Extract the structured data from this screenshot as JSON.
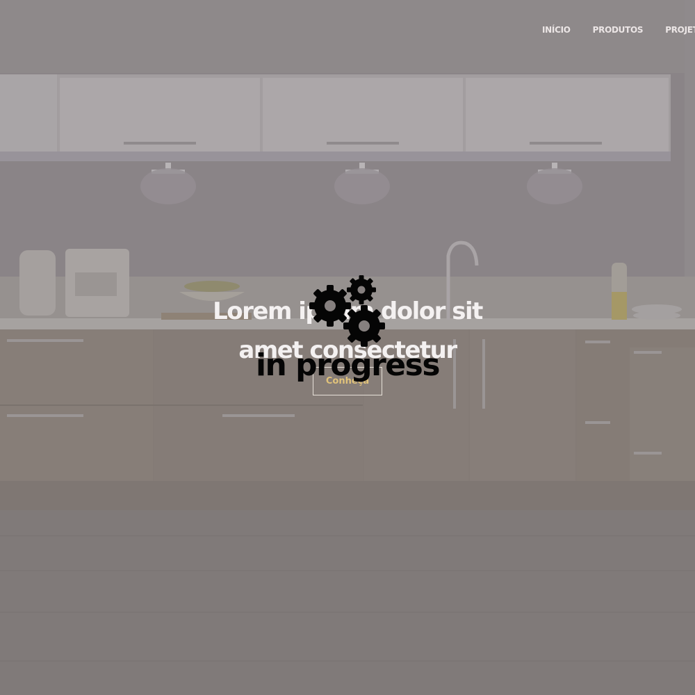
{
  "nav": {
    "items": [
      {
        "label": "INÍCIO"
      },
      {
        "label": "PRODUTOS"
      },
      {
        "label": "PROJETOS"
      }
    ]
  },
  "hero": {
    "title_line1": "Lorem ipsum dolor sit",
    "title_line2": "amet consectetur",
    "cta_label": "Conheça"
  },
  "overlay": {
    "label": "in progress",
    "icon": "gears-icon"
  },
  "colors": {
    "overlay_tint": "#86807f",
    "cta_text": "#e0c27a",
    "label_text": "#050505"
  }
}
